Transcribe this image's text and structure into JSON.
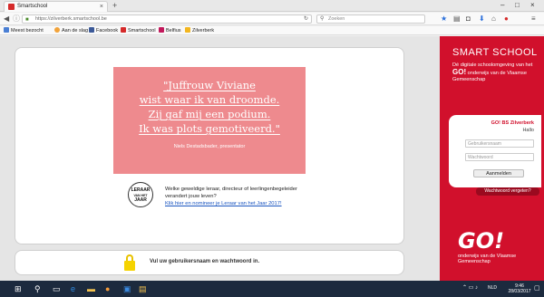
{
  "browser": {
    "tab_title": "Smartschool",
    "tab_close": "×",
    "new_tab": "+",
    "window_controls": {
      "minimize": "–",
      "maximize": "□",
      "close": "×"
    },
    "url": "https://zilverberk.smartschool.be",
    "search_placeholder": "Zoeken",
    "bookmarks": [
      {
        "label": "Meest bezocht",
        "color": "#4a7fd4"
      },
      {
        "label": "Aan de slag",
        "color": "#f2a33a"
      },
      {
        "label": "Facebook",
        "color": "#3b5998"
      },
      {
        "label": "Smartschool",
        "color": "#d52a2a"
      },
      {
        "label": "Belfius",
        "color": "#c2185b"
      },
      {
        "label": "Zilverberk",
        "color": "#f3b61f"
      }
    ]
  },
  "quote": {
    "lines": [
      "\"Juffrouw Viviane",
      "wist waar ik van droomde.",
      "Zij gaf mij een podium.",
      "Ik was plots gemotiveerd.\""
    ],
    "author": "Niels Destadsbader, presentator"
  },
  "badge": {
    "line1": "LERAAR",
    "line2": "VAN HET",
    "line3": "JAAR"
  },
  "promo": {
    "text": "Welke geweldige leraar, directeur of leerlingenbegeleider verandert jouw leven?",
    "link": "Klik hier en nomineer je Leraar van het Jaar 2017!"
  },
  "login_notice": "Vul uw gebruikersnaam en wachtwoord in.",
  "sidebar": {
    "brand": "SMART SCHOOL",
    "tagline_prefix": "Dé digitale schoolomgeving van het",
    "tagline_go": "GO!",
    "tagline_suffix": "onderwijs van de Vlaamse Gemeenschap",
    "school": "GO! BS Zilverberk",
    "greeting": "Hallo",
    "username_placeholder": "Gebruikersnaam",
    "password_placeholder": "Wachtwoord",
    "signin_label": "Aanmelden",
    "forgot_label": "Wachtwoord vergeten?",
    "go_logo": "GO!",
    "go_tagline": "onderwijs van de Vlaamse Gemeenschap",
    "accent": "#d1102c"
  },
  "taskbar": {
    "time": "9:46",
    "date": "28/03/2017",
    "lang": "NLD"
  }
}
